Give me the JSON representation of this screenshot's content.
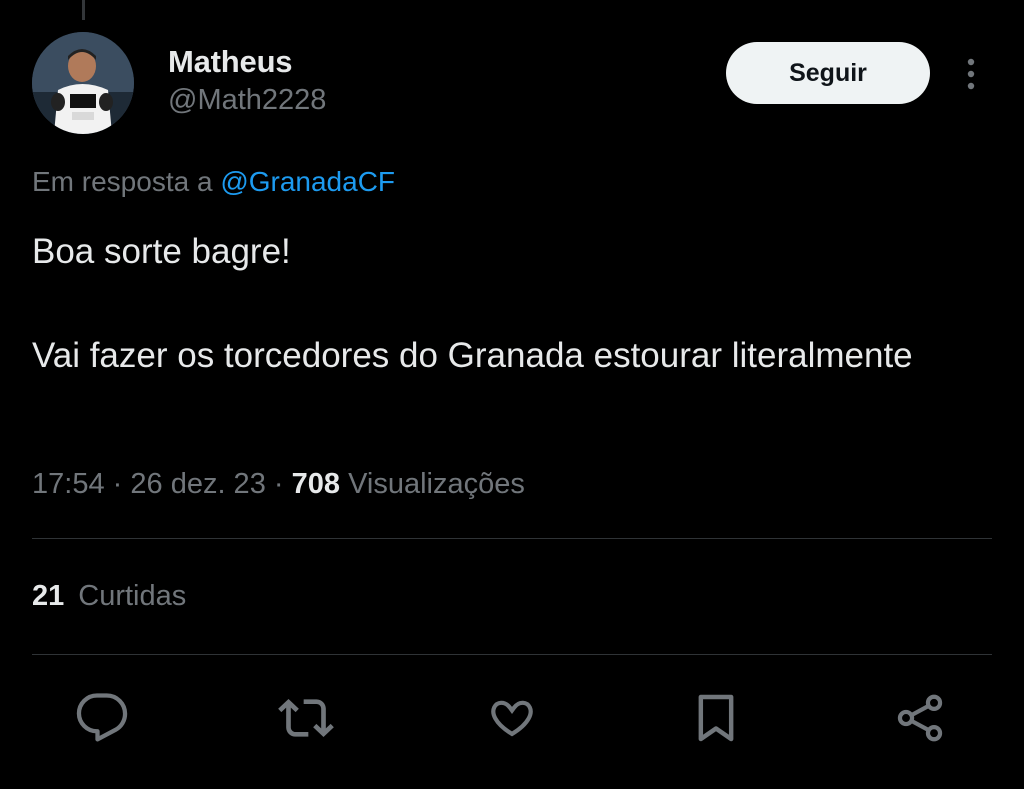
{
  "author": {
    "display_name": "Matheus",
    "handle": "@Math2228"
  },
  "follow_button": {
    "label": "Seguir"
  },
  "reply_context": {
    "prefix": "Em resposta a",
    "mention": "@GranadaCF"
  },
  "tweet": {
    "lines": [
      "Boa sorte bagre!",
      "Vai fazer os torcedores do Granada estourar literalmente"
    ]
  },
  "meta": {
    "time": "17:54",
    "separator": "·",
    "date": "26 dez. 23",
    "views_count": "708",
    "views_label": "Visualizações"
  },
  "likes": {
    "count": "21",
    "label": "Curtidas"
  },
  "actions": {
    "icons": [
      "reply-icon",
      "retweet-icon",
      "like-icon",
      "bookmark-icon",
      "share-icon"
    ]
  },
  "colors": {
    "background": "#000000",
    "text_primary": "#e7e9ea",
    "text_secondary": "#71767b",
    "accent": "#1d9bf0",
    "divider": "#2f3336"
  }
}
